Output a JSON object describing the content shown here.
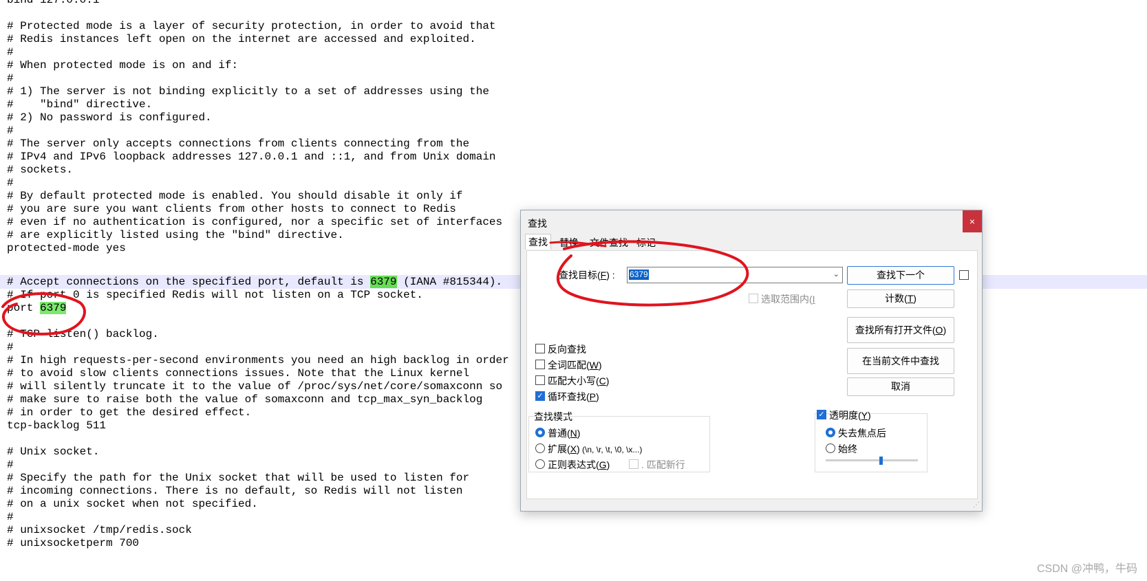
{
  "editor": {
    "lines": [
      "bind 127.0.0.1",
      "",
      "# Protected mode is a layer of security protection, in order to avoid that",
      "# Redis instances left open on the internet are accessed and exploited.",
      "#",
      "# When protected mode is on and if:",
      "#",
      "# 1) The server is not binding explicitly to a set of addresses using the",
      "#    \"bind\" directive.",
      "# 2) No password is configured.",
      "#",
      "# The server only accepts connections from clients connecting from the",
      "# IPv4 and IPv6 loopback addresses 127.0.0.1 and ::1, and from Unix domain",
      "# sockets.",
      "#",
      "# By default protected mode is enabled. You should disable it only if",
      "# you are sure you want clients from other hosts to connect to Redis",
      "# even if no authentication is configured, nor a specific set of interfaces",
      "# are explicitly listed using the \"bind\" directive.",
      "protected-mode yes",
      "",
      "# Accept connections on the specified port, default is 6379 (IANA #815344).",
      "# If port 0 is specified Redis will not listen on a TCP socket.",
      "port 6379",
      "",
      "# TCP listen() backlog.",
      "#",
      "# In high requests-per-second environments you need an high backlog in order",
      "# to avoid slow clients connections issues. Note that the Linux kernel",
      "# will silently truncate it to the value of /proc/sys/net/core/somaxconn so",
      "# make sure to raise both the value of somaxconn and tcp_max_syn_backlog",
      "# in order to get the desired effect.",
      "tcp-backlog 511",
      "",
      "# Unix socket.",
      "#",
      "# Specify the path for the Unix socket that will be used to listen for",
      "# incoming connections. There is no default, so Redis will not listen",
      "# on a unix socket when not specified.",
      "#",
      "# unixsocket /tmp/redis.sock",
      "# unixsocketperm 700"
    ],
    "accept_prefix": "# Accept connections on the specified port, default is ",
    "accept_match": "6379",
    "accept_suffix": " (IANA #815344).",
    "port_prefix": "port ",
    "port_match": "6379"
  },
  "dialog": {
    "title": "查找",
    "close": "×",
    "tabs": [
      "查找",
      "替换",
      "文件查找",
      "标记"
    ],
    "find_label": "查找目标",
    "find_key": "F",
    "find_value": "6379",
    "in_selection": "选取范围内",
    "in_selection_key": "I",
    "btn_find_next": "查找下一个",
    "btn_count": "计数",
    "btn_count_key": "T",
    "btn_find_all_open": "查找所有打开文件",
    "btn_find_all_open_key": "O",
    "btn_find_in_current": "在当前文件中查找",
    "btn_cancel": "取消",
    "opt_backward": "反向查找",
    "opt_whole_word": "全词匹配",
    "opt_whole_word_key": "W",
    "opt_match_case": "匹配大小写",
    "opt_match_case_key": "C",
    "opt_wrap": "循环查找",
    "opt_wrap_key": "P",
    "mode_title": "查找模式",
    "mode_normal": "普通",
    "mode_normal_key": "N",
    "mode_extended": "扩展",
    "mode_extended_key": "X",
    "mode_extended_hint": " (\\n, \\r, \\t, \\0, \\x...)",
    "mode_regex": "正则表达式",
    "mode_regex_key": "G",
    "mode_dot_newline": ". 匹配新行",
    "transparency": "透明度",
    "transparency_key": "Y",
    "trans_on_lose_focus": "失去焦点后",
    "trans_always": "始终",
    "transparency_level": 0.6
  },
  "watermark": "CSDN @冲鸭，牛码",
  "colors": {
    "match_highlight": "#66dd55",
    "current_line": "#e8e8ff",
    "annotation": "#e0141e",
    "accent": "#1f6fd6",
    "close_button": "#c8323c"
  }
}
